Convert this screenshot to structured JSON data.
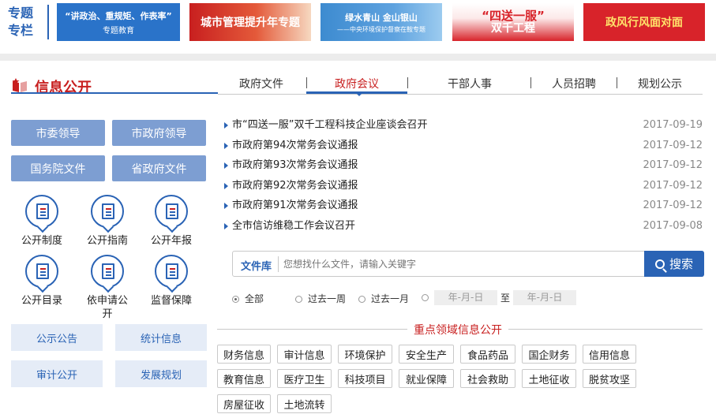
{
  "special": {
    "label_line1": "专题",
    "label_line2": "专栏"
  },
  "banners": [
    {
      "title": "“讲政治、重规矩、作表率”",
      "subtitle": "专题教育"
    },
    {
      "title": "城市管理提升年专题"
    },
    {
      "title": "绿水青山 金山银山",
      "subtitle": "——中央环境保护督察在鞍专题"
    },
    {
      "title": "“四送一服”",
      "subtitle": "双千工程"
    },
    {
      "title": "政风行风面对面"
    }
  ],
  "section": {
    "title": "信息公开"
  },
  "tabs": [
    {
      "label": "政府文件",
      "active": false
    },
    {
      "label": "政府会议",
      "active": true
    },
    {
      "label": "干部人事",
      "active": false
    },
    {
      "label": "人员招聘",
      "active": false
    },
    {
      "label": "规划公示",
      "active": false
    }
  ],
  "left_buttons": [
    "市委领导",
    "市政府领导",
    "国务院文件",
    "省政府文件"
  ],
  "icons": [
    {
      "label": "公开制度",
      "icon": "document-list-icon"
    },
    {
      "label": "公开指南",
      "icon": "guide-book-icon"
    },
    {
      "label": "公开年报",
      "icon": "annual-report-icon"
    },
    {
      "label": "公开目录",
      "icon": "catalog-icon"
    },
    {
      "label": "依申请公开",
      "icon": "apply-edit-icon"
    },
    {
      "label": "监督保障",
      "icon": "supervision-icon"
    }
  ],
  "light_buttons": [
    "公示公告",
    "统计信息",
    "审计公开",
    "发展规划"
  ],
  "news": [
    {
      "title": "市“四送一服”双千工程科技企业座谈会召开",
      "date": "2017-09-19"
    },
    {
      "title": "市政府第94次常务会议通报",
      "date": "2017-09-12"
    },
    {
      "title": "市政府第93次常务会议通报",
      "date": "2017-09-12"
    },
    {
      "title": "市政府第92次常务会议通报",
      "date": "2017-09-12"
    },
    {
      "title": "市政府第91次常务会议通报",
      "date": "2017-09-12"
    },
    {
      "title": "全市信访维稳工作会议召开",
      "date": "2017-09-08"
    }
  ],
  "search": {
    "library_label": "文件库",
    "placeholder": "您想找什么文件，请输入关键字",
    "button_label": "搜索"
  },
  "filters": {
    "options": [
      "全部",
      "过去一周",
      "过去一月"
    ],
    "selected": "全部",
    "date_placeholder": "年-月-日",
    "to_label": "至"
  },
  "key_area": {
    "title": "重点领域信息公开",
    "tags": [
      "财务信息",
      "审计信息",
      "环境保护",
      "安全生产",
      "食品药品",
      "国企财务",
      "信用信息",
      "教育信息",
      "医疗卫生",
      "科技项目",
      "就业保障",
      "社会救助",
      "土地征收",
      "脱贫攻坚",
      "房屋征收",
      "土地流转"
    ]
  },
  "colors": {
    "accent_blue": "#2a63b5",
    "accent_red": "#c81f1f",
    "button_blue": "#7d9ed2",
    "light_button": "#e5ecf7"
  }
}
